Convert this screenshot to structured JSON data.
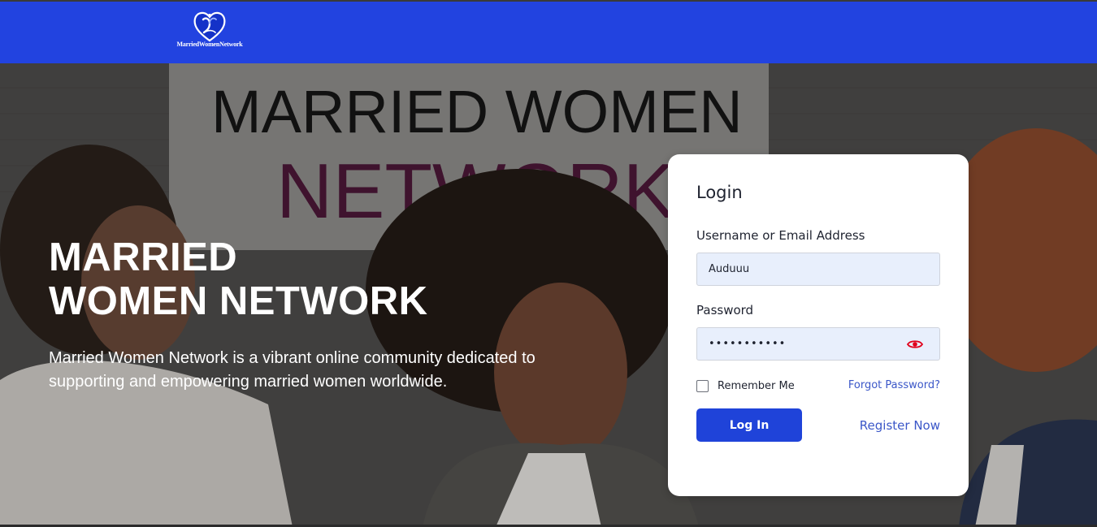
{
  "header": {
    "logo_text": "MarriedWomenNetwork",
    "background_color": "#2243e0"
  },
  "hero": {
    "title_line1": "MARRIED",
    "title_line2": "WOMEN NETWORK",
    "description": "Married Women Network is a vibrant online community dedicated to supporting and empowering married women worldwide.",
    "banner_text_line1": "MARRIED WOMEN",
    "banner_text_line2": "NETWORK"
  },
  "login": {
    "title": "Login",
    "username_label": "Username or Email Address",
    "username_value": "Auduuu",
    "password_label": "Password",
    "password_value": "•••••••••••",
    "remember_label": "Remember Me",
    "remember_checked": false,
    "forgot_label": "Forgot Password?",
    "login_button": "Log In",
    "register_label": "Register Now",
    "eye_icon": "eye-icon",
    "accent_color": "#1f43d9",
    "link_color": "#3b57c8",
    "eye_color": "#e0001b"
  }
}
